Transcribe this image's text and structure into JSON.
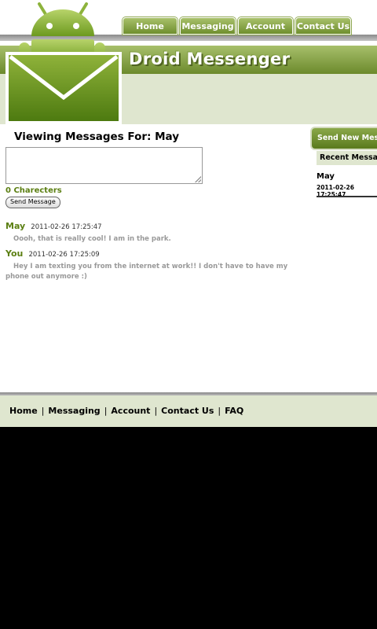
{
  "nav": {
    "tabs": [
      "Home",
      "Messaging",
      "Account",
      "Contact Us"
    ]
  },
  "brand": {
    "title": "Droid Messenger",
    "logo_icon": "android-envelope-icon",
    "accent": "#6f8f2e",
    "light_band": "#dfe6cf"
  },
  "compose": {
    "heading": "Viewing Messages For: May",
    "textarea_value": "",
    "char_count": "0 Charecters",
    "send_label": "Send Message"
  },
  "messages": [
    {
      "sender": "May",
      "time": "2011-02-26 17:25:47",
      "text": "Oooh, that is really cool! I am in the park."
    },
    {
      "sender": "You",
      "time": "2011-02-26 17:25:09",
      "text": "Hey I am texting you from the internet at work!! I don't have to have my phone out anymore :)"
    }
  ],
  "sidebar": {
    "send_new": "Send New Message",
    "recent_heading": "Recent Messages",
    "recent": [
      {
        "name": "May",
        "time": "2011-02-26 17:25:47"
      }
    ]
  },
  "footer": {
    "links": [
      "Home",
      "Messaging",
      "Account",
      "Contact Us",
      "FAQ"
    ]
  }
}
